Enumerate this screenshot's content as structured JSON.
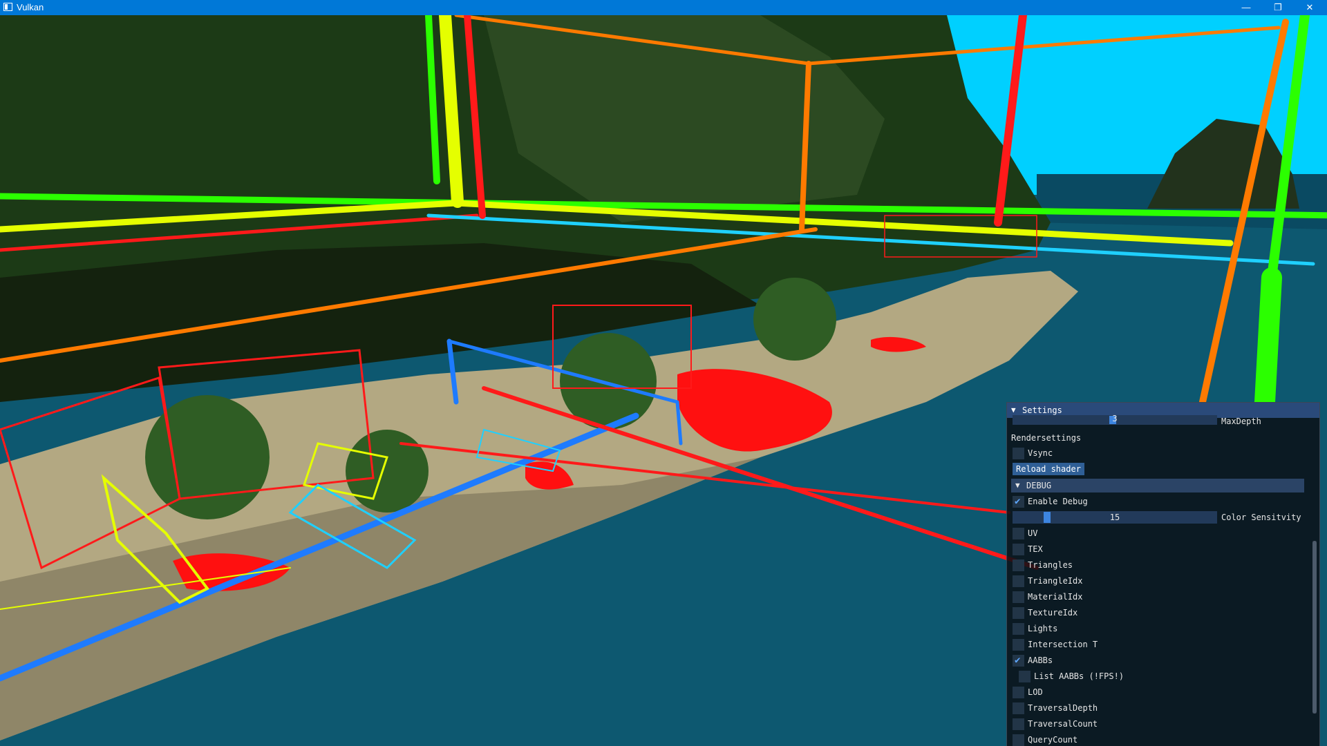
{
  "window": {
    "title": "Vulkan",
    "controls": {
      "minimize": "—",
      "maximize": "❐",
      "close": "✕"
    }
  },
  "scene": {
    "sky_color": "#00d0ff",
    "sea_color": "#0d5870",
    "sand_color": "#b3a882",
    "jungle_color": "#1c3a16"
  },
  "settings": {
    "header": "Settings",
    "maxdepth_label": "MaxDepth",
    "maxdepth_value": "3",
    "render_label": "Rendersettings",
    "vsync_label": "Vsync",
    "vsync_checked": false,
    "reload_shader_label": "Reload shader",
    "debug_section_label": "DEBUG",
    "enable_debug_label": "Enable Debug",
    "enable_debug_checked": true,
    "color_sensitivity_label": "Color Sensitvity",
    "color_sensitivity_value": "15",
    "debug_items": [
      {
        "label": "UV",
        "checked": false
      },
      {
        "label": "TEX",
        "checked": false
      },
      {
        "label": "Triangles",
        "checked": false
      },
      {
        "label": "TriangleIdx",
        "checked": false
      },
      {
        "label": "MaterialIdx",
        "checked": false
      },
      {
        "label": "TextureIdx",
        "checked": false
      },
      {
        "label": "Lights",
        "checked": false
      },
      {
        "label": "Intersection T",
        "checked": false
      },
      {
        "label": "AABBs",
        "checked": true
      }
    ],
    "list_aabbs_label": "List AABBs (!FPS!)",
    "list_aabbs_checked": false,
    "more_items": [
      {
        "label": "LOD",
        "checked": false
      },
      {
        "label": "TraversalDepth",
        "checked": false
      },
      {
        "label": "TraversalCount",
        "checked": false
      },
      {
        "label": "QueryCount",
        "checked": false
      }
    ],
    "accent": "#3d85e0"
  }
}
